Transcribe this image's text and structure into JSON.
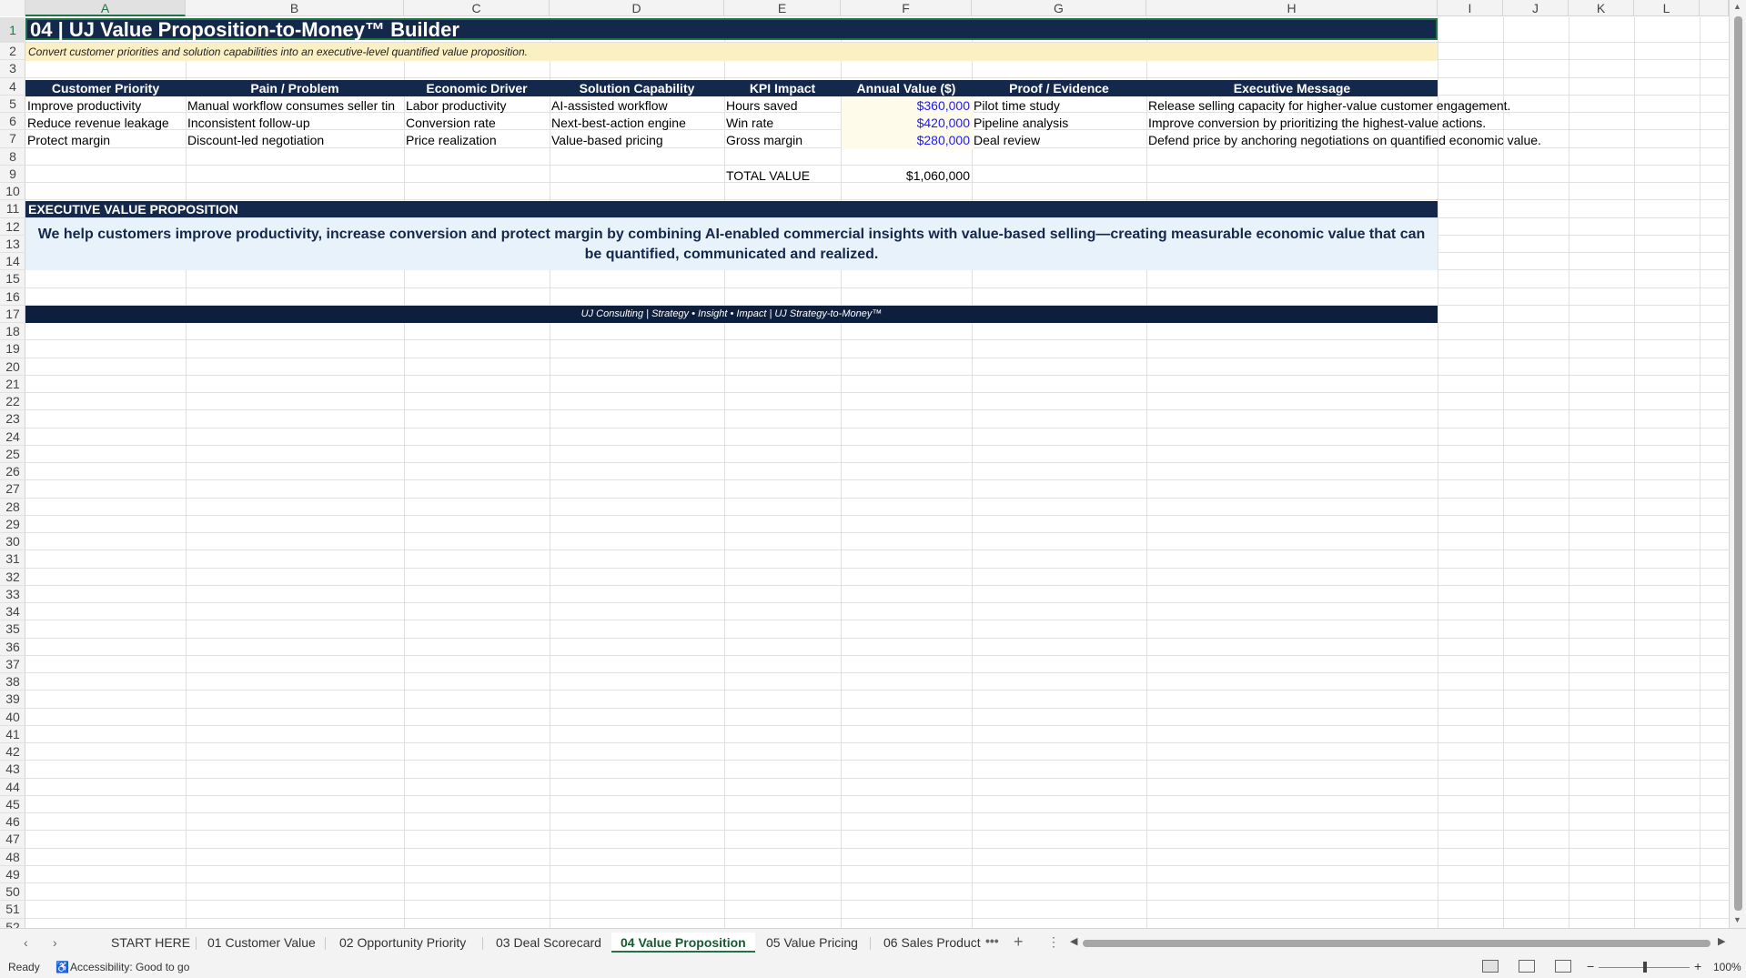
{
  "columns": [
    "A",
    "B",
    "C",
    "D",
    "E",
    "F",
    "G",
    "H",
    "I",
    "J",
    "K",
    "L"
  ],
  "rows": [
    "1",
    "2",
    "3",
    "4",
    "5",
    "6",
    "7",
    "8",
    "9",
    "10",
    "11",
    "12",
    "13",
    "14",
    "15",
    "16",
    "17",
    "18",
    "19",
    "20",
    "21",
    "22",
    "23",
    "24",
    "25",
    "26",
    "27",
    "28",
    "29",
    "30",
    "31",
    "32",
    "33",
    "34",
    "35",
    "36",
    "37",
    "38",
    "39",
    "40",
    "41",
    "42",
    "43",
    "44",
    "45",
    "46",
    "47",
    "48",
    "49",
    "50",
    "51",
    "52"
  ],
  "title": "04 | UJ Value Proposition-to-Money™ Builder",
  "subtitle": "Convert customer priorities and solution capabilities into an executive-level quantified value proposition.",
  "table": {
    "headers": [
      "Customer Priority",
      "Pain / Problem",
      "Economic Driver",
      "Solution Capability",
      "KPI Impact",
      "Annual Value ($)",
      "Proof / Evidence",
      "Executive Message"
    ],
    "rows": [
      [
        "Improve productivity",
        "Manual workflow consumes seller tin",
        "Labor productivity",
        "AI-assisted workflow",
        "Hours saved",
        "$360,000",
        "Pilot time study",
        "Release selling capacity for higher-value customer engagement."
      ],
      [
        "Reduce revenue leakage",
        "Inconsistent follow-up",
        "Conversion rate",
        "Next-best-action engine",
        "Win rate",
        "$420,000",
        "Pipeline analysis",
        "Improve conversion by prioritizing the highest-value actions."
      ],
      [
        "Protect margin",
        "Discount-led negotiation",
        "Price realization",
        "Value-based pricing",
        "Gross margin",
        "$280,000",
        "Deal review",
        "Defend price by anchoring negotiations on quantified economic value."
      ]
    ],
    "total_label": "TOTAL VALUE",
    "total_value": "$1,060,000"
  },
  "evp": {
    "title": "EXECUTIVE VALUE PROPOSITION",
    "body": "We help customers improve productivity, increase conversion and protect margin by combining AI-enabled commercial insights with value-based selling—creating measurable economic value that can be quantified, communicated and realized."
  },
  "footer": "UJ Consulting | Strategy • Insight • Impact | UJ Strategy-to-Money™",
  "tabs": [
    "START HERE",
    "01 Customer Value",
    "02 Opportunity Priority",
    "03 Deal Scorecard",
    "04 Value Proposition",
    "05 Value Pricing",
    "06 Sales Product"
  ],
  "active_tab": "04 Value Proposition",
  "status": {
    "ready": "Ready",
    "accessibility": "Accessibility: Good to go",
    "zoom": "100%"
  },
  "icons": {
    "tab_prev": "chevron-left-icon",
    "tab_next": "chevron-right-icon",
    "more_tabs": "ellipsis-icon",
    "add_sheet": "plus-icon",
    "tab_menu": "vertical-ellipsis-icon",
    "normal_view": "normal-view-icon",
    "page_layout": "page-layout-icon",
    "page_break": "page-break-icon"
  },
  "colors": {
    "header_navy": "#14284b",
    "subtitle_fill": "#fbefc4",
    "amount_blue": "#1a1aff",
    "evp_fill": "#e8f2fb",
    "excel_green": "#217346"
  }
}
